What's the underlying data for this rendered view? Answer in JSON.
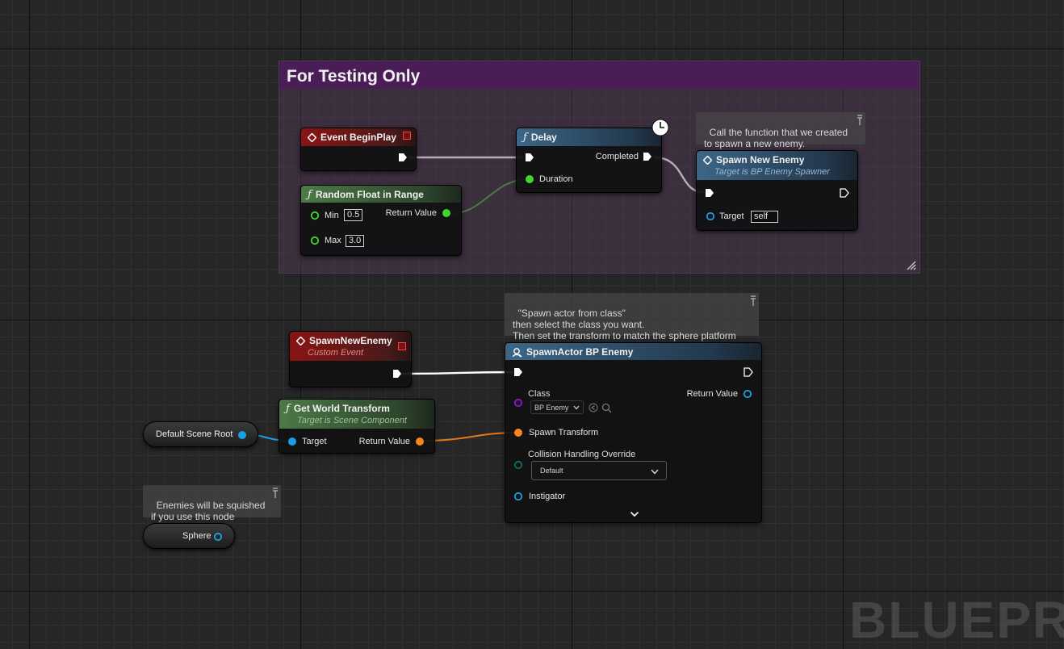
{
  "comment": {
    "title": "For Testing Only"
  },
  "colors": {
    "exec": "#ffffff",
    "float": "#9ff73c",
    "object": "#18a0e8",
    "transform": "#f5851f",
    "class": "#6a1ea8",
    "collision": "#0b6e6e"
  },
  "nodes": {
    "begin_play": {
      "title": "Event BeginPlay",
      "icon": "event-diamond-icon"
    },
    "random_float": {
      "title": "Random Float in Range",
      "icon": "function-icon",
      "min_label": "Min",
      "min_value": "0.5",
      "max_label": "Max",
      "max_value": "3.0",
      "return_label": "Return Value"
    },
    "delay": {
      "title": "Delay",
      "icon": "function-icon",
      "completed_label": "Completed",
      "duration_label": "Duration",
      "latent_icon": "clock-icon"
    },
    "spawn_new_enemy": {
      "title": "Spawn New Enemy",
      "subtitle": "Target is BP Enemy Spawner",
      "target_label": "Target",
      "target_value": "self"
    },
    "custom_event": {
      "title": "SpawnNewEnemy",
      "subtitle": "Custom Event"
    },
    "get_world_transform": {
      "title": "Get World Transform",
      "subtitle": "Target is Scene Component",
      "target_label": "Target",
      "return_label": "Return Value"
    },
    "spawn_actor": {
      "title": "SpawnActor BP Enemy",
      "class_label": "Class",
      "class_value": "BP Enemy",
      "return_label": "Return Value",
      "spawn_transform_label": "Spawn Transform",
      "collision_label": "Collision Handling Override",
      "collision_value": "Default",
      "instigator_label": "Instigator"
    },
    "default_scene_root": {
      "label": "Default Scene Root"
    },
    "sphere": {
      "label": "Sphere"
    }
  },
  "notes": {
    "spawn_note": "Call the function that we created\nto spawn a new enemy.",
    "spawn_actor_note": "\"Spawn actor from class\"\nthen select the class you want.\nThen set the transform to match the sphere platform",
    "sphere_note": "Enemies will be squished\nif you use this node"
  },
  "watermark": "BLUEPRINT"
}
